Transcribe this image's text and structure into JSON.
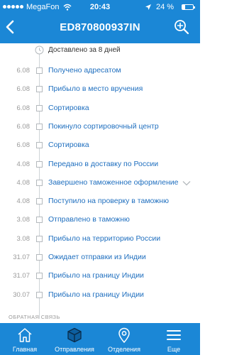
{
  "status_bar": {
    "carrier": "MegaFon",
    "time": "20:43",
    "battery": "24 %",
    "battery_level": 0.24
  },
  "nav": {
    "title": "ED870800937IN",
    "back_icon": "chevron-left-icon",
    "action_icon": "zoom-in-icon"
  },
  "timeline": {
    "summary": "Доставлено за 8 дней",
    "events": [
      {
        "date": "6.08",
        "label": "Получено адресатом"
      },
      {
        "date": "6.08",
        "label": "Прибыло в место вручения"
      },
      {
        "date": "6.08",
        "label": "Сортировка"
      },
      {
        "date": "6.08",
        "label": "Покинуло сортировочный центр"
      },
      {
        "date": "6.08",
        "label": "Сортировка"
      },
      {
        "date": "4.08",
        "label": "Передано в доставку по России"
      },
      {
        "date": "4.08",
        "label": "Завершено таможенное оформление"
      },
      {
        "date": "4.08",
        "label": "Поступило на проверку в таможню"
      },
      {
        "date": "3.08",
        "label": "Отправлено в таможню"
      },
      {
        "date": "3.08",
        "label": "Прибыло на территорию России"
      },
      {
        "date": "31.07",
        "label": "Ожидает отправки из Индии"
      },
      {
        "date": "31.07",
        "label": "Прибыло на границу Индии"
      },
      {
        "date": "30.07",
        "label": "Прибыло на границу Индии"
      }
    ],
    "feedback_label": "ОБРАТНАЯ СВЯЗЬ"
  },
  "tabs": [
    {
      "label": "Главная",
      "icon": "home-icon"
    },
    {
      "label": "Отправления",
      "icon": "parcel-box-icon"
    },
    {
      "label": "Отделения",
      "icon": "map-pin-icon"
    },
    {
      "label": "Еще",
      "icon": "menu-icon"
    }
  ],
  "colors": {
    "accent": "#1b87d6",
    "link": "#1f6fbf",
    "muted": "#9a9a9a"
  }
}
